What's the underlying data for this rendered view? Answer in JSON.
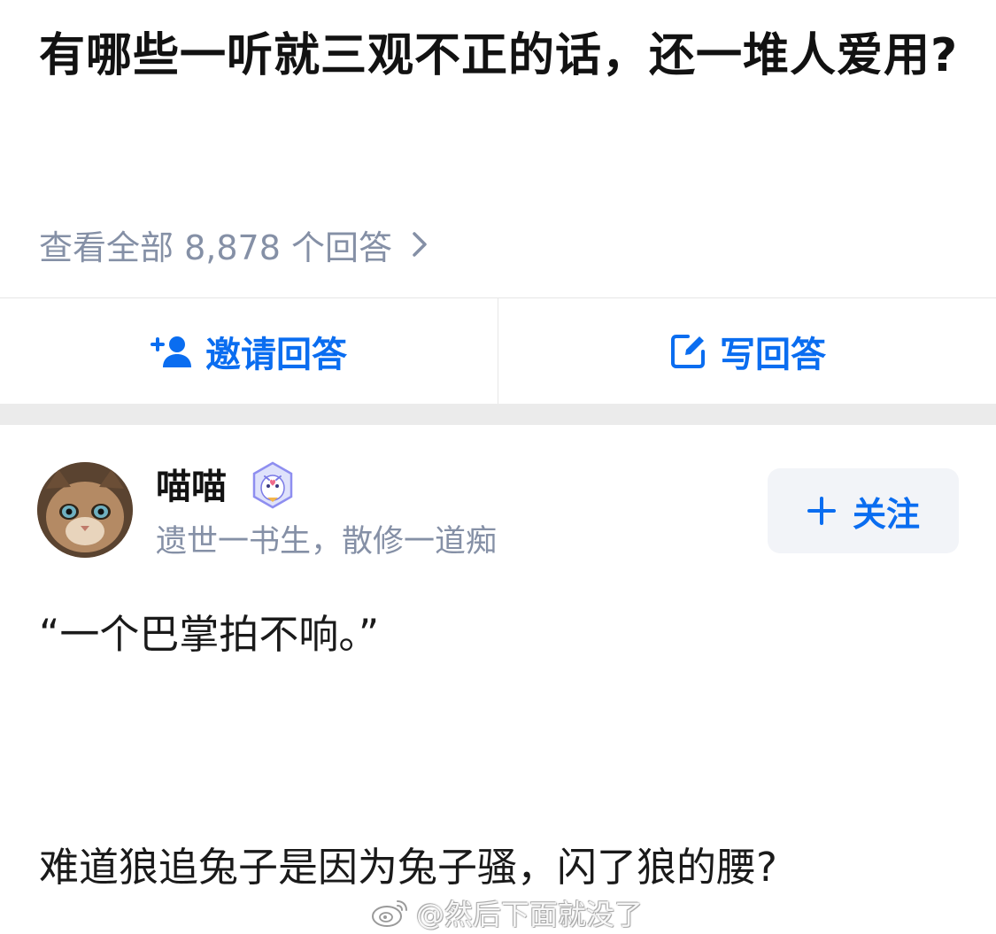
{
  "question": {
    "title": "有哪些一听就三观不正的话，还一堆人爱用?",
    "view_all_label": "查看全部 8,878 个回答"
  },
  "actions": {
    "invite_label": "邀请回答",
    "write_label": "写回答"
  },
  "author": {
    "name": "喵喵",
    "bio": "遗世一书生，散修一道痴",
    "follow_label": "关注"
  },
  "answer": {
    "paragraph1": "“一个巴掌拍不响。”",
    "paragraph2": "难道狼追兔子是因为兔子骚，闪了狼的腰?"
  },
  "watermark": {
    "text": "@然后下面就没了"
  },
  "colors": {
    "accent": "#0a6df0",
    "muted": "#8590a6",
    "band": "#ebebeb"
  }
}
